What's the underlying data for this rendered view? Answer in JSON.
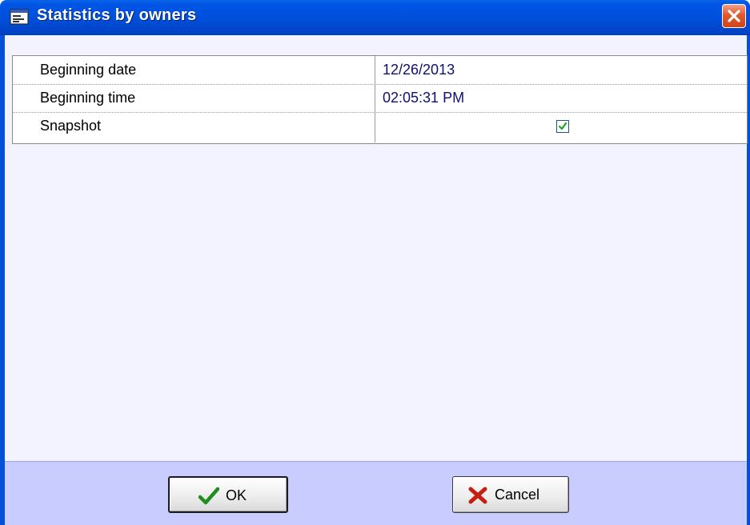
{
  "window": {
    "title": "Statistics by owners",
    "title_icon": "window-app-icon",
    "close_icon": "close-icon",
    "colors": {
      "titlebar": "#0055e5",
      "close": "#e2582e",
      "client": "#f3f3ff",
      "footer": "#c8ccff",
      "value_text": "#10106e"
    }
  },
  "properties": [
    {
      "name": "Beginning date",
      "value": "12/26/2013"
    },
    {
      "name": "Beginning time",
      "value": "02:05:31 PM"
    },
    {
      "name": "Snapshot",
      "checked": true
    }
  ],
  "buttons": {
    "ok_label": "OK",
    "ok_icon": "checkmark-icon",
    "cancel_label": "Cancel",
    "cancel_icon": "x-mark-icon"
  }
}
